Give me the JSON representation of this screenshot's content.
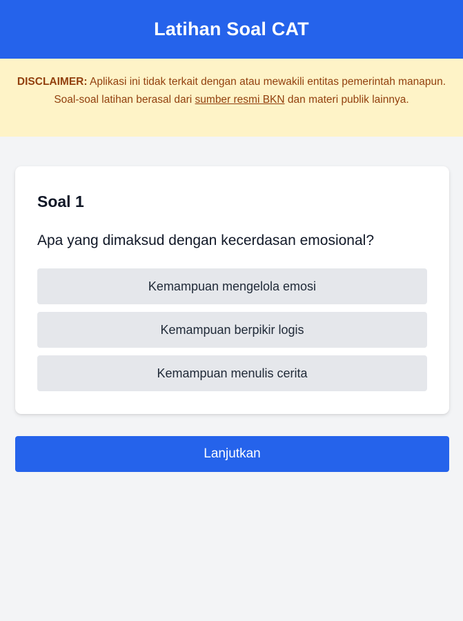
{
  "header": {
    "title": "Latihan Soal CAT"
  },
  "disclaimer": {
    "label": "DISCLAIMER:",
    "text_before_link": " Aplikasi ini tidak terkait dengan atau mewakili entitas pemerintah manapun. Soal-soal latihan berasal dari ",
    "link_text": "sumber resmi BKN",
    "text_after_link": " dan materi publik lainnya."
  },
  "question": {
    "number_label": "Soal 1",
    "text": "Apa yang dimaksud dengan kecerdasan emosional?",
    "options": [
      "Kemampuan mengelola emosi",
      "Kemampuan berpikir logis",
      "Kemampuan menulis cerita"
    ]
  },
  "actions": {
    "next_label": "Lanjutkan"
  },
  "colors": {
    "primary": "#2563eb",
    "disclaimer_bg": "#fef3c7",
    "disclaimer_text": "#92400e",
    "option_bg": "#e5e7eb",
    "page_bg": "#f3f4f6"
  }
}
